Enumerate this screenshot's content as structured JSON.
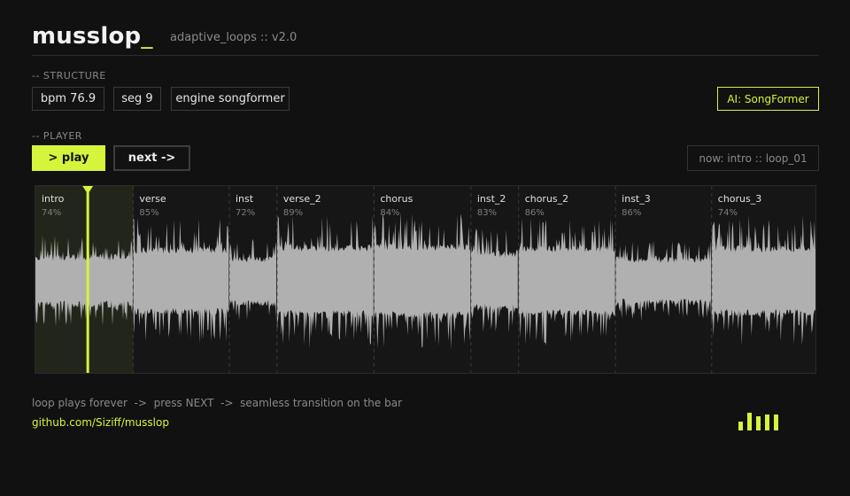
{
  "header": {
    "title": "musslop",
    "cursor": "_",
    "subtitle": "adaptive_loops :: v2.0"
  },
  "structure": {
    "label": "-- STRUCTURE",
    "chips": [
      "bpm 76.9",
      "seg 9",
      "engine songformer"
    ],
    "ai_badge": "AI: SongFormer"
  },
  "player": {
    "label": "-- PLAYER",
    "play_label": "> play",
    "next_label": "next ->",
    "now_playing": "now: intro :: loop_01"
  },
  "waveform": {
    "playhead_fraction": 0.067,
    "active_segment": 0,
    "segments": [
      {
        "name": "intro",
        "pct": "74%",
        "start": 0.0,
        "end": 0.125,
        "level": 0.35
      },
      {
        "name": "verse",
        "pct": "85%",
        "start": 0.125,
        "end": 0.248,
        "level": 0.7
      },
      {
        "name": "inst",
        "pct": "72%",
        "start": 0.248,
        "end": 0.309,
        "level": 0.3
      },
      {
        "name": "verse_2",
        "pct": "89%",
        "start": 0.309,
        "end": 0.433,
        "level": 0.8
      },
      {
        "name": "chorus",
        "pct": "84%",
        "start": 0.433,
        "end": 0.557,
        "level": 0.85
      },
      {
        "name": "inst_2",
        "pct": "83%",
        "start": 0.557,
        "end": 0.618,
        "level": 0.5
      },
      {
        "name": "chorus_2",
        "pct": "86%",
        "start": 0.618,
        "end": 0.742,
        "level": 0.75
      },
      {
        "name": "inst_3",
        "pct": "86%",
        "start": 0.742,
        "end": 0.865,
        "level": 0.25
      },
      {
        "name": "chorus_3",
        "pct": "74%",
        "start": 0.865,
        "end": 1.0,
        "level": 0.75
      }
    ]
  },
  "footer": {
    "hint": "loop plays forever  ->  press NEXT  ->  seamless transition on the bar",
    "link": "github.com/Siziff/musslop"
  },
  "meter": {
    "levels": [
      0.42,
      0.83,
      0.67,
      0.75,
      0.75
    ]
  },
  "colors": {
    "accent": "#d4f53c",
    "background": "#111111",
    "wave": "#b0b0b0"
  }
}
